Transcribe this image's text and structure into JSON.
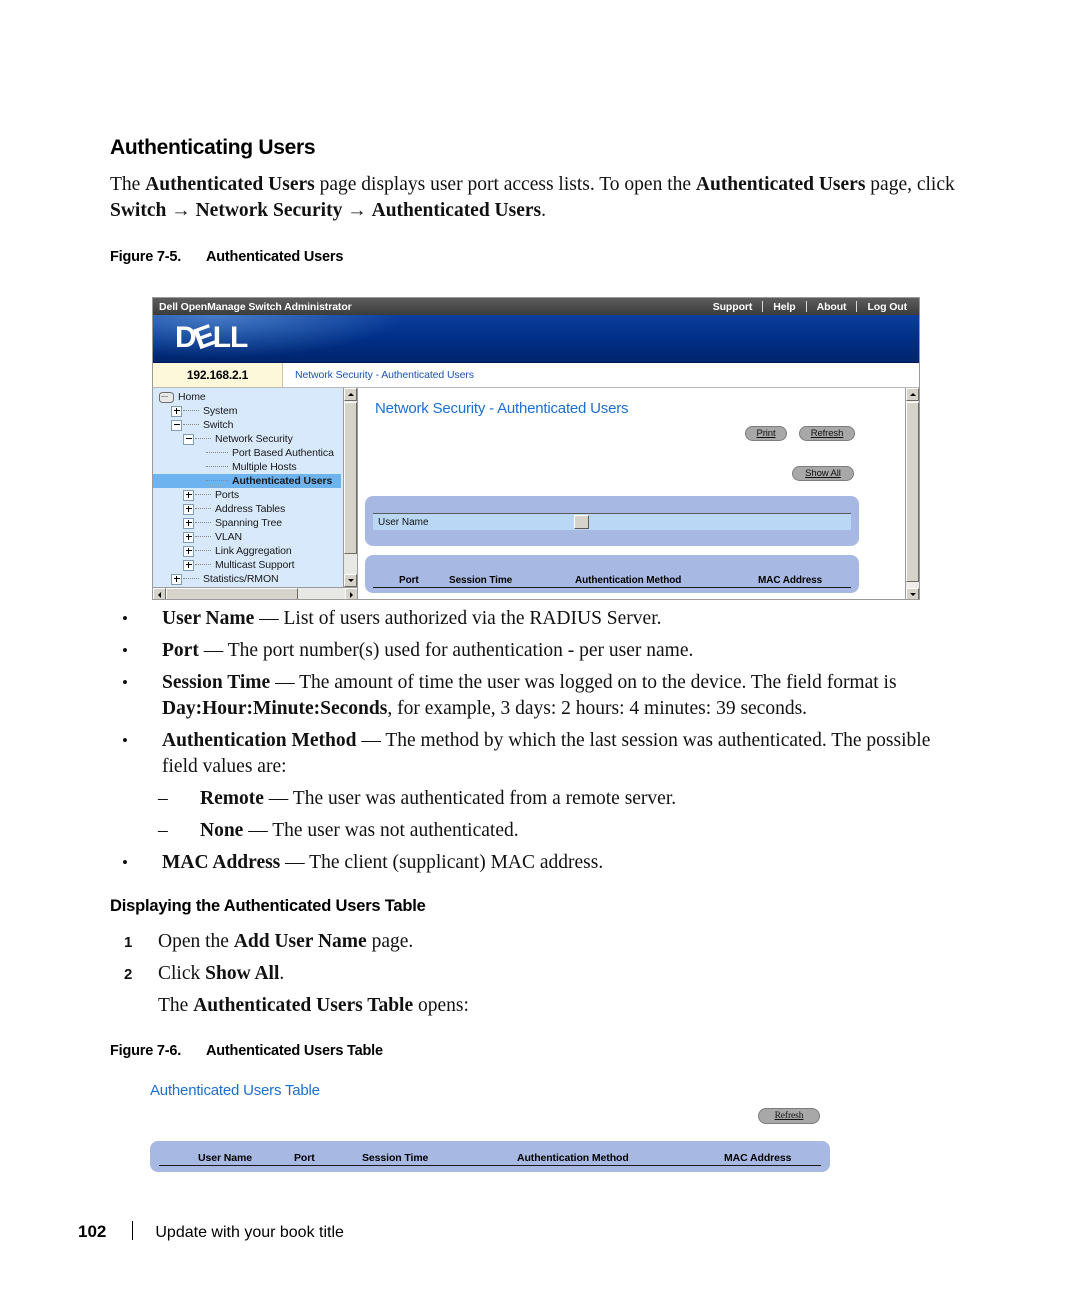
{
  "document": {
    "heading": "Authenticating Users",
    "intro_html": "The <b>Authenticated Users</b> page displays user port access lists. To open the <b>Authenticated Users</b> page, click <b>Switch</b> &rarr; <b>Network Security</b> &rarr; <b>Authenticated Users</b>.",
    "figure_5_label": "Figure 7-5.",
    "figure_5_title": "Authenticated Users",
    "figure_6_label": "Figure 7-6.",
    "figure_6_title": "Authenticated Users Table",
    "section_heading": "Displaying the Authenticated Users Table",
    "steps": [
      {
        "number": "1",
        "html": "Open the <b>Add User Name</b> page."
      },
      {
        "number": "2",
        "html": "Click <b>Show All</b>."
      }
    ],
    "step_note_html": "The <b>Authenticated Users Table</b> opens:",
    "bullets": [
      {
        "html": "<b>User Name</b> &mdash; List of users authorized via the RADIUS Server."
      },
      {
        "html": "<b>Port</b> &mdash; The port number(s) used for authentication - per user name."
      },
      {
        "html": "<b>Session Time</b> &mdash; The amount of time the user was logged on to the device. The field format is <b>Day:Hour:Minute:Seconds</b>, for example, 3 days: 2 hours: 4 minutes: 39 seconds."
      },
      {
        "html": "<b>Authentication Method</b> &mdash; The method by which the last session was authenticated. The possible field values are:"
      }
    ],
    "sub_bullets": [
      {
        "html": "<b>Remote</b> &mdash; The user was authenticated from a remote server."
      },
      {
        "html": "<b>None</b> &mdash; The user was not authenticated."
      }
    ],
    "bullet_last": {
      "html": "<b>MAC Address</b> &mdash; The client (supplicant) MAC address."
    },
    "footer": {
      "page_number": "102",
      "text": "Update with your book title"
    }
  },
  "omsa": {
    "titlebar": {
      "app_title": "Dell OpenManage Switch Administrator",
      "links": [
        "Support",
        "Help",
        "About",
        "Log Out"
      ]
    },
    "brand": {
      "logo_text_1": "D",
      "logo_text_e": "E",
      "logo_text_2": "LL"
    },
    "crumbbar": {
      "ip_address": "192.168.2.1",
      "breadcrumb": "Network Security - Authenticated Users"
    },
    "tree": [
      {
        "label": "Home",
        "indent": 0,
        "toggle": "none",
        "icon": "home-icon",
        "selected": false
      },
      {
        "label": "System",
        "indent": 1,
        "toggle": "plus",
        "icon": "",
        "selected": false
      },
      {
        "label": "Switch",
        "indent": 1,
        "toggle": "minus",
        "icon": "",
        "selected": false
      },
      {
        "label": "Network Security",
        "indent": 2,
        "toggle": "minus",
        "icon": "",
        "selected": false
      },
      {
        "label": "Port Based Authentica",
        "indent": 3,
        "toggle": "none",
        "icon": "",
        "selected": false
      },
      {
        "label": "Multiple Hosts",
        "indent": 3,
        "toggle": "none",
        "icon": "",
        "selected": false
      },
      {
        "label": "Authenticated Users",
        "indent": 3,
        "toggle": "none",
        "icon": "",
        "selected": true
      },
      {
        "label": "Ports",
        "indent": 2,
        "toggle": "plus",
        "icon": "",
        "selected": false
      },
      {
        "label": "Address Tables",
        "indent": 2,
        "toggle": "plus",
        "icon": "",
        "selected": false
      },
      {
        "label": "Spanning Tree",
        "indent": 2,
        "toggle": "plus",
        "icon": "",
        "selected": false
      },
      {
        "label": "VLAN",
        "indent": 2,
        "toggle": "plus",
        "icon": "",
        "selected": false
      },
      {
        "label": "Link Aggregation",
        "indent": 2,
        "toggle": "plus",
        "icon": "",
        "selected": false
      },
      {
        "label": "Multicast Support",
        "indent": 2,
        "toggle": "plus",
        "icon": "",
        "selected": false
      },
      {
        "label": "Statistics/RMON",
        "indent": 1,
        "toggle": "plus",
        "icon": "",
        "selected": false
      }
    ],
    "content": {
      "page_title": "Network Security - Authenticated Users",
      "buttons": {
        "print": "Print",
        "refresh": "Refresh",
        "show_all": "Show All"
      },
      "form": {
        "user_name_label": "User Name",
        "user_name_value": ""
      },
      "table_headers": [
        "Port",
        "Session Time",
        "Authentication Method",
        "MAC Address"
      ]
    }
  },
  "users_table": {
    "title": "Authenticated Users Table",
    "refresh_label": "Refresh",
    "headers": [
      "User Name",
      "Port",
      "Session Time",
      "Authentication Method",
      "MAC Address"
    ],
    "rows": []
  },
  "colors": {
    "dell_blue": "#002f87",
    "link_blue": "#1b6fd0",
    "tree_bg": "#d7e9fa",
    "tree_selected": "#6cb3f0",
    "panel_blue": "#a7b9e2",
    "field_blue": "#bad8f5",
    "ip_yellow": "#fdf8d9"
  }
}
